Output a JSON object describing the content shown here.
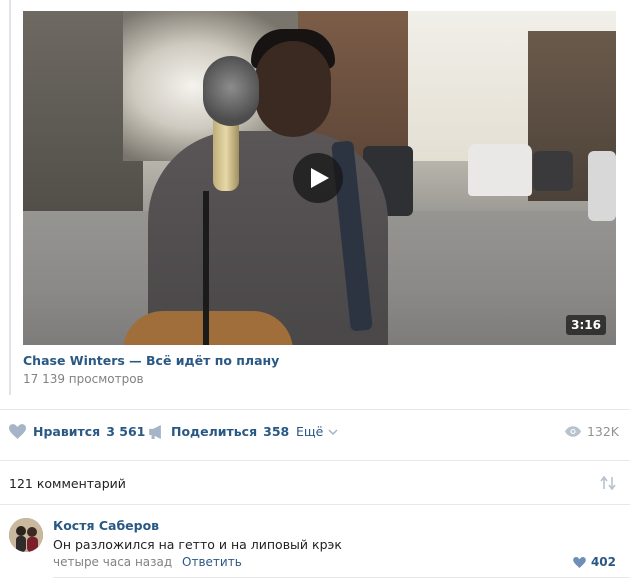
{
  "video": {
    "duration": "3:16",
    "title": "Chase Winters — Всё идёт по плану",
    "views": "17 139 просмотров"
  },
  "actions": {
    "like_label": "Нравится",
    "like_count": "3 561",
    "share_label": "Поделиться",
    "share_count": "358",
    "more_label": "Ещё",
    "views_count": "132K"
  },
  "comments": {
    "header": "121 комментарий",
    "items": [
      {
        "author": "Костя Саберов",
        "text": "Он разложился на гетто и на липовый крэк",
        "time": "четыре часа назад",
        "reply_label": "Ответить",
        "likes": "402"
      }
    ]
  },
  "colors": {
    "link": "#2a5885",
    "muted": "#828282",
    "divider": "#e7e8ec"
  }
}
